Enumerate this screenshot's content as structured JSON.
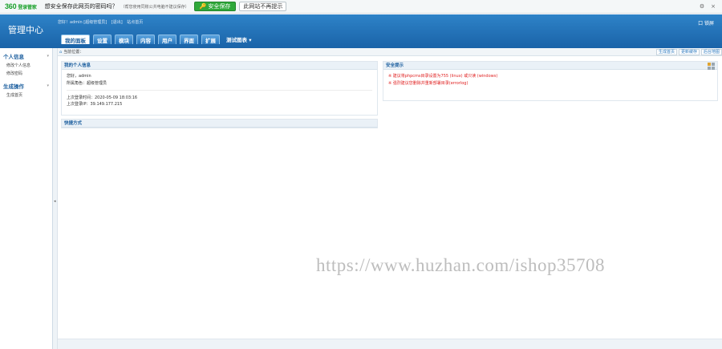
{
  "topbar": {
    "logo": "360",
    "logo_sub": "登录管家",
    "question": "想安全保存此网页的密码吗？",
    "note": "（帮您使用同账公共电脑不建议保存）",
    "save_button": "安全保存",
    "no_prompt_button": "此网站不再提示",
    "settings_icon": "gear-icon",
    "close_label": "×"
  },
  "header": {
    "brand": "管理中心",
    "user_line": [
      "您好！admin [超级管理员]",
      "[退出]",
      "站点首页"
    ],
    "right_label": "口 锁屏",
    "nav": [
      "我的面板",
      "设置",
      "模块",
      "内容",
      "用户",
      "界面",
      "扩展",
      "测试图表 ▾"
    ]
  },
  "sidebar": {
    "groups": [
      {
        "title": "个人信息",
        "items": [
          "修改个人信息",
          "修改密码"
        ]
      },
      {
        "title": "生成操作",
        "items": [
          "生成首页"
        ]
      }
    ]
  },
  "crumb": {
    "label": "当前位置：",
    "quick_links": [
      "生成首页",
      "更新缓存",
      "后台地图"
    ]
  },
  "panels": {
    "my_info": {
      "title": "我的个人信息",
      "hello": "您好，admin",
      "role": "所属角色：超级管理员",
      "last_login_time": "上次登录时间：2020-05-09 18:03:16",
      "last_login_ip": "上次登录IP：39.149.177.215"
    },
    "shortcuts": {
      "title": "快捷方式"
    },
    "security": {
      "title": "安全提示",
      "alerts": [
        "※ 建议将phpcms目录设置为755 (linux) 或只读 (windows)",
        "※ 强烈建议您删除并重新部署目录(errorlog)"
      ]
    }
  },
  "watermark": "https://www.huzhan.com/ishop35708",
  "colors": {
    "header_blue": "#1a63a8",
    "save_green": "#2fa83a",
    "alert_red": "#e02020"
  }
}
